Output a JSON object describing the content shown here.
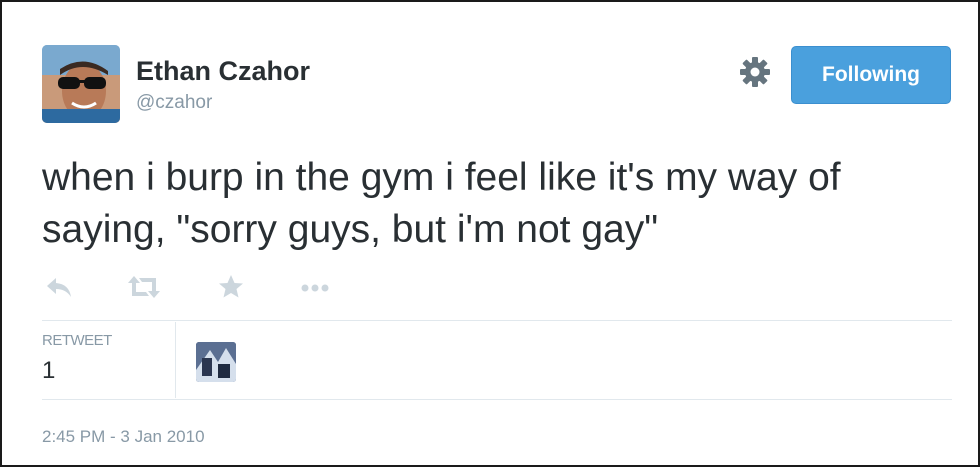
{
  "user": {
    "name": "Ethan Czahor",
    "handle": "@czahor"
  },
  "follow_button": {
    "label": "Following"
  },
  "tweet": {
    "text": "when i burp in the gym i feel like it's my way of saying, \"sorry guys, but i'm not gay\""
  },
  "actions": {
    "icons": [
      "reply-icon",
      "retweet-icon",
      "favorite-icon",
      "more-icon"
    ]
  },
  "stats": {
    "retweet_label": "RETWEET",
    "retweet_count": "1"
  },
  "timestamp": "2:45 PM - 3 Jan 2010",
  "colors": {
    "follow_button": "#4aa0dd",
    "secondary_text": "#8899a6",
    "icon": "#ccd6dd"
  }
}
